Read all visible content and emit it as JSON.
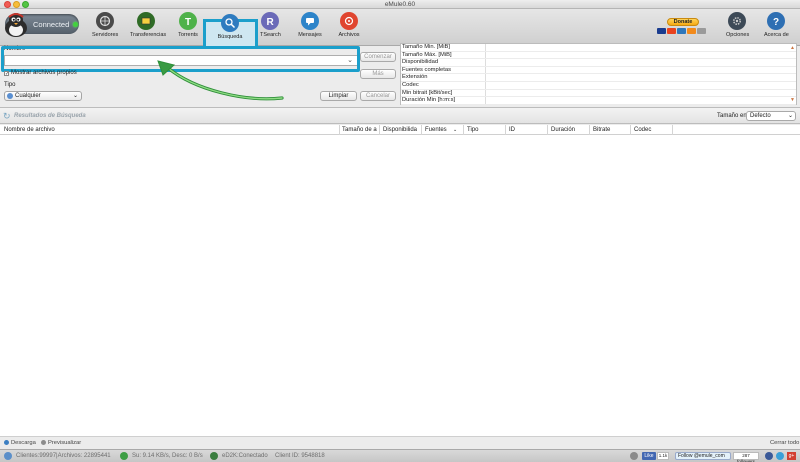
{
  "window": {
    "title": "eMule0.60"
  },
  "connection": {
    "label": "Connected",
    "status_color": "#43d13d"
  },
  "toolbar": {
    "items": [
      {
        "label": "Servidores",
        "icon": "servers-icon",
        "color": "#4a4a4a"
      },
      {
        "label": "Transferencias",
        "icon": "transfers-icon",
        "color": "#3a8a2a"
      },
      {
        "label": "Torrents",
        "icon": "torrent-icon",
        "color": "#4fb24a"
      },
      {
        "label": "Búsqueda",
        "icon": "search-icon",
        "color": "#2e7bbf",
        "selected": true
      },
      {
        "label": "TSearch",
        "icon": "tsearch-icon",
        "color": "#5d5ca8"
      },
      {
        "label": "Mensajes",
        "icon": "messages-icon",
        "color": "#2d84c9"
      },
      {
        "label": "Archivos",
        "icon": "files-icon",
        "color": "#e0452f"
      }
    ],
    "donate_label": "Donate",
    "options_label": "Opciones",
    "about_label": "Acerca de"
  },
  "search": {
    "name_label": "Nombre",
    "name_value": "",
    "own_files_label": "Mostrar archivos propios",
    "own_files_checked": true,
    "type_label": "Tipo",
    "type_value": "Cualquier",
    "start_button": "Comenzar",
    "more_button": "Más",
    "clear_button": "Limpiar",
    "cancel_button": "Cancelar"
  },
  "properties": [
    "Tamaño Min. [MiB]",
    "Tamaño Máx. [MiB]",
    "Disponibilidad",
    "Fuentes completas",
    "Extensión",
    "Codec",
    "Min bitrait [kBit/sec]",
    "Duración Min [h:m:s]"
  ],
  "results": {
    "title": "Resultados de Búsqueda",
    "size_in_label": "Tamaño en",
    "size_unit": "Defecto",
    "columns": [
      "Nombre de archivo",
      "Tamaño de a",
      "Disponibilida",
      "Fuentes",
      "Tipo",
      "ID",
      "Duración",
      "Bitrate",
      "Codec"
    ]
  },
  "bottom_actions": {
    "download": "Descarga",
    "preview": "Previsualizar",
    "close_all": "Cerrar todo"
  },
  "status": {
    "clients": "Clientes:99997|Archivos: 22895441",
    "speed": "Su: 9.14 KB/s, Desc: 0 B/s",
    "network": "eD2K:Conectado",
    "client_id": "Client ID: 9548818",
    "fb_like": "Like",
    "fb_count": "1.1k",
    "twitter_follow": "Follow @emule_com",
    "twitter_count": "287 followers"
  }
}
